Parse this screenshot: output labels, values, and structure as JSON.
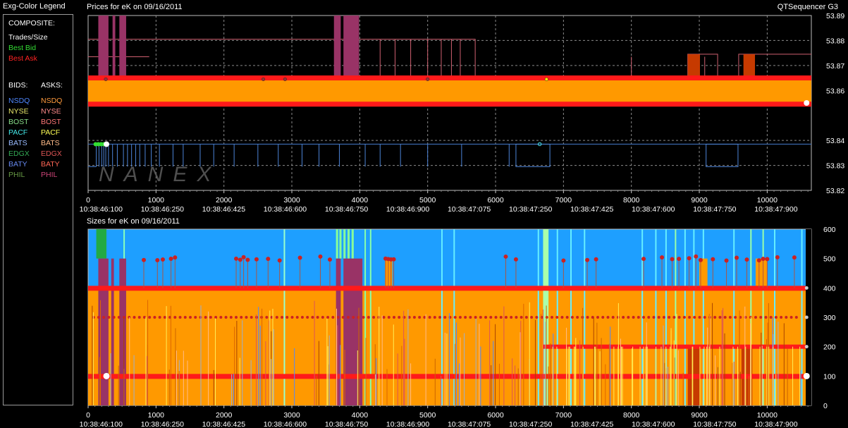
{
  "legend": {
    "title": "Exg-Color Legend",
    "composite_header": "COMPOSITE:",
    "composite": [
      {
        "label": "Trades/Size",
        "color": "#ffffff"
      },
      {
        "label": "Best Bid",
        "color": "#33dd33"
      },
      {
        "label": "Best Ask",
        "color": "#ff2222"
      }
    ],
    "bids_header": "BIDS:",
    "asks_header": "ASKS:",
    "exchanges": [
      {
        "bid": "NSDQ",
        "bid_color": "#4f88ff",
        "ask": "NSDQ",
        "ask_color": "#ff9a3c"
      },
      {
        "bid": "NYSE",
        "bid_color": "#e8e86a",
        "ask": "NYSE",
        "ask_color": "#ff8c8c"
      },
      {
        "bid": "BOST",
        "bid_color": "#88dd88",
        "ask": "BOST",
        "ask_color": "#ff7777"
      },
      {
        "bid": "PACF",
        "bid_color": "#44e8e8",
        "ask": "PACF",
        "ask_color": "#ffff55"
      },
      {
        "bid": "BATS",
        "bid_color": "#99bbff",
        "ask": "BATS",
        "ask_color": "#ffbb88"
      },
      {
        "bid": "EDGX",
        "bid_color": "#33aa55",
        "ask": "EDGX",
        "ask_color": "#dd5555"
      },
      {
        "bid": "BATY",
        "bid_color": "#6688ee",
        "ask": "BATY",
        "ask_color": "#ff6655"
      },
      {
        "bid": "PHIL",
        "bid_color": "#669944",
        "ask": "PHIL",
        "ask_color": "#cc4477"
      }
    ]
  },
  "watermark": "NANEX",
  "app_name": "QTSequencer G3",
  "chart_data": [
    {
      "type": "line",
      "title": "Prices for  eK  on  09/16/2011",
      "ylim": [
        53.82,
        53.89
      ],
      "y_ticks": [
        "53.89",
        "53.88",
        "53.87",
        "53.86",
        "53.84",
        "53.83",
        "53.82"
      ],
      "xlim": [
        0,
        10650
      ],
      "x_ticks": [
        "0",
        "1000",
        "2000",
        "3000",
        "4000",
        "5000",
        "6000",
        "7000",
        "8000",
        "9000",
        "10000"
      ],
      "time_labels": [
        "10:38:46:100",
        "10:38:46:250",
        "10:38:46:425",
        "10:38:46:600",
        "10:38:46:750",
        "10:38:46:900",
        "10:38:47:075",
        "10:38:47:250",
        "10:38:47:425",
        "10:38:47:600",
        "10:38:47:750",
        "10:38:47:900"
      ],
      "series": [
        {
          "name": "Best Ask",
          "color": "#ff1a1a",
          "values": [
            53.865,
            53.865
          ]
        },
        {
          "name": "Best Bid",
          "color": "#ff1a1a",
          "values": [
            53.855,
            53.855
          ]
        }
      ]
    },
    {
      "type": "bar",
      "title": "Sizes for  eK  on  09/16/2011",
      "ylim": [
        0,
        600
      ],
      "y_ticks": [
        "600",
        "500",
        "400",
        "300",
        "200",
        "100",
        "0"
      ],
      "xlim": [
        0,
        10650
      ],
      "x_ticks": [
        "0",
        "1000",
        "2000",
        "3000",
        "4000",
        "5000",
        "6000",
        "7000",
        "8000",
        "9000",
        "10000"
      ],
      "time_labels": [
        "10:38:46:100",
        "10:38:46:250",
        "10:38:46:425",
        "10:38:46:600",
        "10:38:46:750",
        "10:38:46:900",
        "10:38:47:075",
        "10:38:47:250",
        "10:38:47:425",
        "10:38:47:600",
        "10:38:47:750",
        "10:38:47:900"
      ],
      "series": [
        {
          "name": "Best Bid",
          "color": "#1e9fff",
          "values": [
            600,
            600
          ]
        },
        {
          "name": "Best Ask",
          "color": "#ff9900",
          "values": [
            400,
            400
          ]
        },
        {
          "name": "Trades/Size",
          "color": "#ffffff",
          "values": [
            100,
            100
          ]
        }
      ]
    }
  ]
}
